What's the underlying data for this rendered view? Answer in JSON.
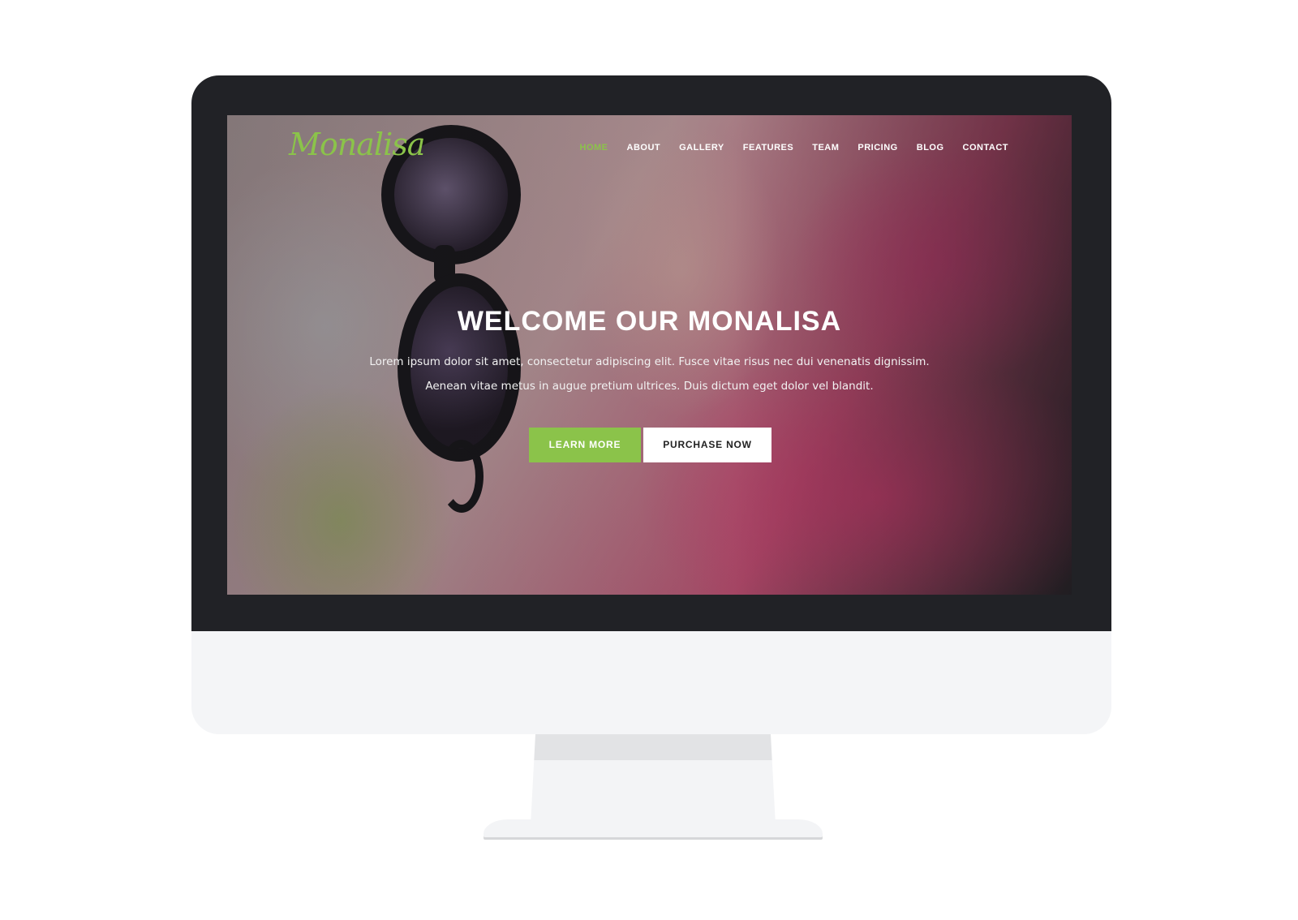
{
  "site": {
    "logo": "Monalisa",
    "accent_color": "#8bc34a"
  },
  "nav": {
    "items": [
      {
        "label": "HOME",
        "active": true
      },
      {
        "label": "ABOUT",
        "active": false
      },
      {
        "label": "GALLERY",
        "active": false
      },
      {
        "label": "FEATURES",
        "active": false
      },
      {
        "label": "TEAM",
        "active": false
      },
      {
        "label": "PRICING",
        "active": false
      },
      {
        "label": "BLOG",
        "active": false
      },
      {
        "label": "CONTACT",
        "active": false
      }
    ]
  },
  "hero": {
    "title": "WELCOME OUR MONALISA",
    "line1": "Lorem ipsum dolor sit amet, consectetur adipiscing elit. Fusce vitae risus nec dui venenatis dignissim.",
    "line2": "Aenean vitae metus in augue pretium ultrices. Duis dictum eget dolor vel blandit.",
    "learn_more": "LEARN MORE",
    "purchase_now": "PURCHASE NOW"
  }
}
